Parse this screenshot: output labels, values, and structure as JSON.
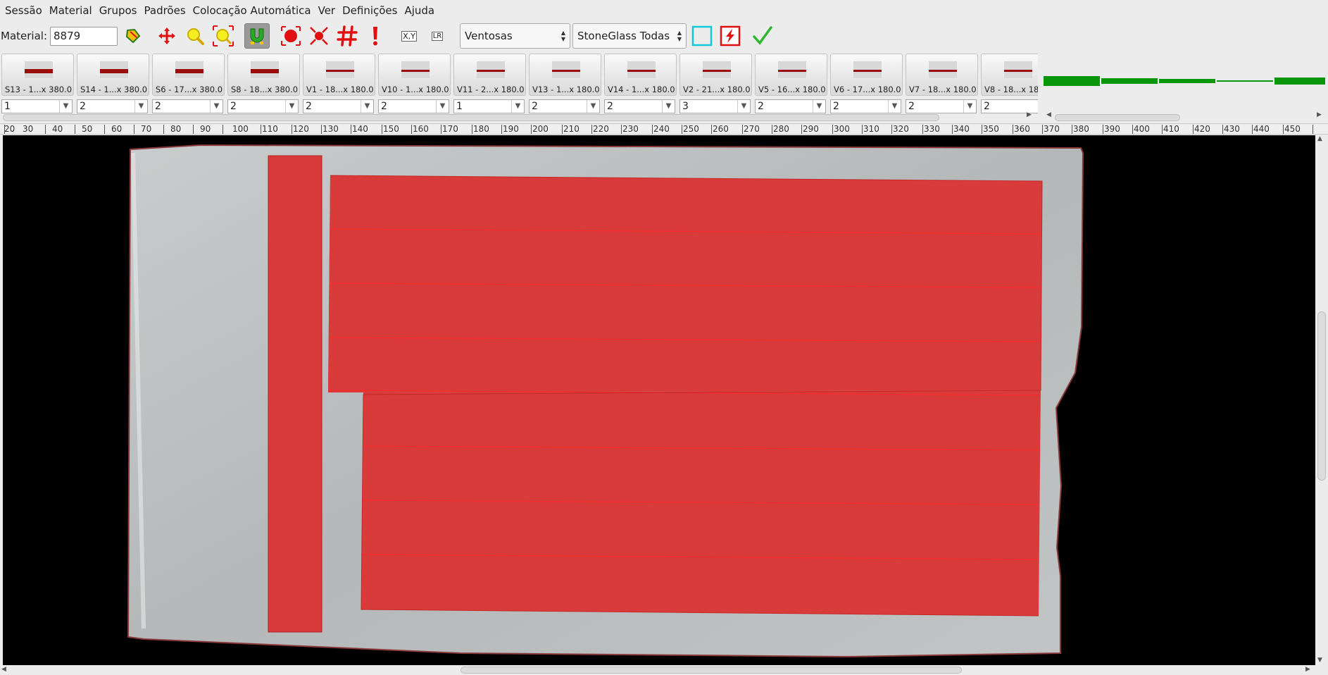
{
  "menu": [
    "Sessão",
    "Material",
    "Grupos",
    "Padrões",
    "Colocação Automática",
    "Ver",
    "Definições",
    "Ajuda"
  ],
  "toolbar": {
    "material_label": "Material:",
    "material_value": "8879",
    "xy_label": "X,Y",
    "lr_label": "LR",
    "suction_select": "Ventosas",
    "machine_select": "StoneGlass Todas"
  },
  "parts": [
    {
      "caption": "S13 - 1...x 380.0",
      "qty": "1",
      "bar": "thick"
    },
    {
      "caption": "S14 - 1...x 380.0",
      "qty": "2",
      "bar": "thick"
    },
    {
      "caption": "S6 - 17...x 380.0",
      "qty": "2",
      "bar": "thick"
    },
    {
      "caption": "S8 - 18...x 380.0",
      "qty": "2",
      "bar": "thick"
    },
    {
      "caption": "V1 - 18...x 180.0",
      "qty": "2",
      "bar": "thin"
    },
    {
      "caption": "V10 - 1...x 180.0",
      "qty": "2",
      "bar": "thin"
    },
    {
      "caption": "V11 - 2...x 180.0",
      "qty": "1",
      "bar": "thin"
    },
    {
      "caption": "V13 - 1...x 180.0",
      "qty": "2",
      "bar": "thin"
    },
    {
      "caption": "V14 - 1...x 180.0",
      "qty": "2",
      "bar": "thin"
    },
    {
      "caption": "V2 - 21...x 180.0",
      "qty": "3",
      "bar": "thin"
    },
    {
      "caption": "V5 - 16...x 180.0",
      "qty": "2",
      "bar": "thin"
    },
    {
      "caption": "V6 - 17...x 180.0",
      "qty": "2",
      "bar": "thin"
    },
    {
      "caption": "V7 - 18...x 180.0",
      "qty": "2",
      "bar": "thin"
    },
    {
      "caption": "V8 - 18...x 18",
      "qty": "2",
      "bar": "thin"
    }
  ],
  "ruler": [
    "20",
    "30",
    "40",
    "50",
    "60",
    "70",
    "80",
    "90",
    "100",
    "110",
    "120",
    "130",
    "140",
    "150",
    "160",
    "170",
    "180",
    "190",
    "200",
    "210",
    "220",
    "230",
    "240",
    "250",
    "260",
    "270",
    "280",
    "290",
    "300",
    "310",
    "320",
    "330",
    "340",
    "350",
    "360",
    "370",
    "380",
    "390",
    "400",
    "410",
    "420",
    "430",
    "440",
    "450"
  ],
  "colors": {
    "piece_fill": "#d93a3a",
    "piece_line": "#ff2a2a",
    "level_green": "#0a960a",
    "check_green": "#2fb82f",
    "tool_red": "#e01010",
    "slab_grey": "#b9bcbc"
  }
}
